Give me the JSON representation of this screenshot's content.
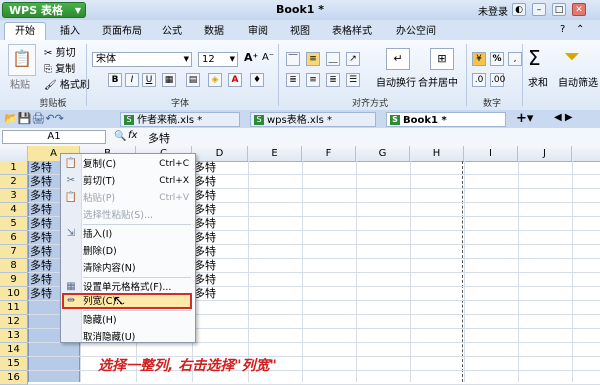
{
  "titlebar": {
    "app": "WPS 表格",
    "doc_title": "Book1 *",
    "login": "未登录",
    "min": "–",
    "max": "□",
    "close": "✕"
  },
  "tabs": [
    "开始",
    "插入",
    "页面布局",
    "公式",
    "数据",
    "审阅",
    "视图",
    "表格样式",
    "办公空间"
  ],
  "ribbon": {
    "clipboard": {
      "paste": "粘贴",
      "cut": "剪切",
      "copy": "复制",
      "format_painter": "格式刷",
      "label": "剪贴板"
    },
    "font": {
      "name": "宋体",
      "size": "12",
      "grow": "A⁺",
      "shrink": "A⁻",
      "bold": "B",
      "italic": "I",
      "underline": "U",
      "label": "字体"
    },
    "align": {
      "wrap": "自动换行",
      "merge": "合并居中",
      "label": "对齐方式"
    },
    "number": {
      "percent": "%",
      "label": "数字"
    },
    "sum": "求和",
    "filter": "自动筛选"
  },
  "doctabs": [
    {
      "name": "作者来稿.xls *"
    },
    {
      "name": "wps表格.xls *"
    },
    {
      "name": "Book1 *"
    }
  ],
  "formula": {
    "namebox": "A1",
    "fx": "fx",
    "content": "多特"
  },
  "columns": [
    "A",
    "B",
    "C",
    "D",
    "E",
    "F",
    "G",
    "H",
    "I",
    "J"
  ],
  "rows": [
    "1",
    "2",
    "3",
    "4",
    "5",
    "6",
    "7",
    "8",
    "9",
    "10",
    "11",
    "12",
    "13",
    "14",
    "15",
    "16"
  ],
  "cell_text": "多特",
  "filled_rows": 10,
  "context_menu": [
    {
      "label": "复制(C)",
      "shortcut": "Ctrl+C",
      "enabled": true,
      "icon": "📋"
    },
    {
      "label": "剪切(T)",
      "shortcut": "Ctrl+X",
      "enabled": true,
      "icon": "✂"
    },
    {
      "label": "粘贴(P)",
      "shortcut": "Ctrl+V",
      "enabled": false,
      "icon": "📋"
    },
    {
      "label": "选择性粘贴(S)...",
      "shortcut": "",
      "enabled": false,
      "icon": ""
    },
    {
      "label": "插入(I)",
      "shortcut": "",
      "enabled": true,
      "icon": "⇲"
    },
    {
      "label": "删除(D)",
      "shortcut": "",
      "enabled": true,
      "icon": ""
    },
    {
      "label": "清除内容(N)",
      "shortcut": "",
      "enabled": true,
      "icon": ""
    },
    {
      "label": "设置单元格格式(F)...",
      "shortcut": "",
      "enabled": true,
      "icon": "▦"
    },
    {
      "label": "列宽(C)...",
      "shortcut": "",
      "enabled": true,
      "icon": "⇹"
    },
    {
      "label": "隐藏(H)",
      "shortcut": "",
      "enabled": true,
      "icon": ""
    },
    {
      "label": "取消隐藏(U)",
      "shortcut": "",
      "enabled": true,
      "icon": ""
    }
  ],
  "annotation": "选择一整列, 右击选择\"列宽\"",
  "colors": {
    "accent": "#d42b2b",
    "selection": "#b7cbe8",
    "highlight": "#fde9a8"
  }
}
